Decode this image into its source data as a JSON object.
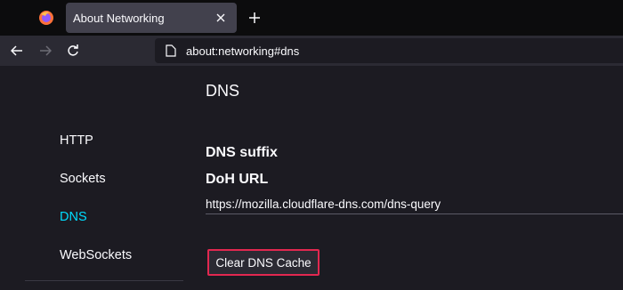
{
  "browser": {
    "tab": {
      "title": "About Networking"
    },
    "url": "about:networking#dns",
    "icons": [
      "firefox-logo-icon",
      "close-icon",
      "plus-icon",
      "back-arrow-icon",
      "forward-arrow-icon",
      "reload-icon",
      "page-icon"
    ]
  },
  "sidebar": {
    "items": [
      {
        "label": "HTTP",
        "active": false
      },
      {
        "label": "Sockets",
        "active": false
      },
      {
        "label": "DNS",
        "active": true
      },
      {
        "label": "WebSockets",
        "active": false
      }
    ]
  },
  "main": {
    "title": "DNS",
    "dns_suffix_heading": "DNS suffix",
    "doh_url_heading": "DoH URL",
    "doh_url_value": "https://mozilla.cloudflare-dns.com/dns-query",
    "clear_button_label": "Clear DNS Cache"
  },
  "colors": {
    "accent_active": "#00ddff",
    "highlight_border": "#e22850",
    "background": "#1c1b22"
  }
}
